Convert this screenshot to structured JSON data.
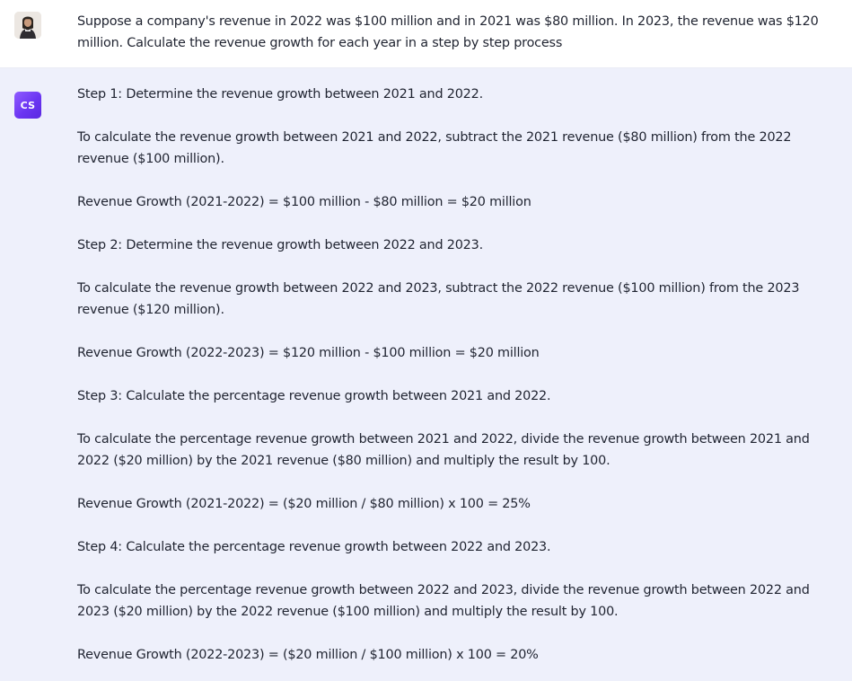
{
  "conversation": {
    "user_message": {
      "text": "Suppose a company's revenue in 2022 was $100 million and in 2021 was $80 million. In 2023, the revenue was $120 million. Calculate the revenue growth for each year in a step by step process"
    },
    "assistant_message": {
      "avatar_label": "CS",
      "paragraphs": [
        "Step 1: Determine the revenue growth between 2021 and 2022.",
        "To calculate the revenue growth between 2021 and 2022, subtract the 2021 revenue ($80 million) from the 2022 revenue ($100 million).",
        "Revenue Growth (2021-2022) = $100 million - $80 million = $20 million",
        "Step 2: Determine the revenue growth between 2022 and 2023.",
        "To calculate the revenue growth between 2022 and 2023, subtract the 2022 revenue ($100 million) from the 2023 revenue ($120 million).",
        "Revenue Growth (2022-2023) = $120 million - $100 million = $20 million",
        "Step 3: Calculate the percentage revenue growth between 2021 and 2022.",
        "To calculate the percentage revenue growth between 2021 and 2022, divide the revenue growth between 2021 and 2022 ($20 million) by the 2021 revenue ($80 million) and multiply the result by 100.",
        "Revenue Growth (2021-2022) = ($20 million / $80 million) x 100 = 25%",
        "Step 4: Calculate the percentage revenue growth between 2022 and 2023.",
        "To calculate the percentage revenue growth between 2022 and 2023, divide the revenue growth between 2022 and 2023 ($20 million) by the 2022 revenue ($100 million) and multiply the result by 100.",
        "Revenue Growth (2022-2023) = ($20 million / $100 million) x 100 = 20%"
      ]
    }
  },
  "icons": {
    "user_avatar": "user-photo-avatar",
    "assistant_avatar": "assistant-logo-avatar"
  },
  "colors": {
    "user_bg": "#ffffff",
    "assistant_bg": "#eef0fb",
    "text": "#1f2330",
    "assistant_avatar_gradient_start": "#8f5cff",
    "assistant_avatar_gradient_end": "#5a28e0"
  }
}
